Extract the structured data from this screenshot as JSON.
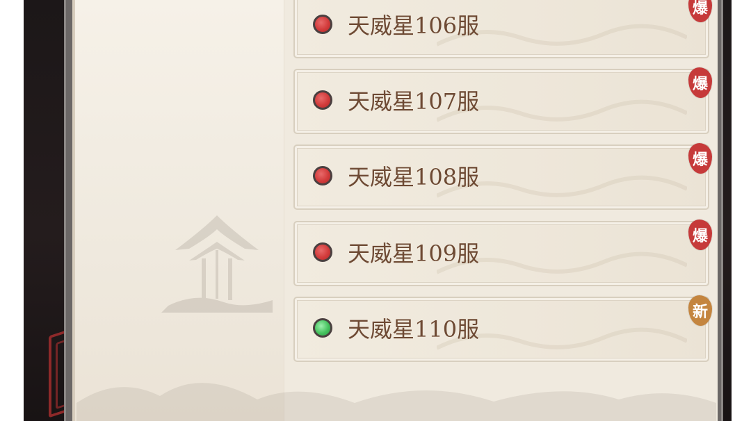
{
  "server_list": {
    "items": [
      {
        "name": "天威星106服",
        "status": "hot",
        "badge": "爆"
      },
      {
        "name": "天威星107服",
        "status": "hot",
        "badge": "爆"
      },
      {
        "name": "天威星108服",
        "status": "hot",
        "badge": "爆"
      },
      {
        "name": "天威星109服",
        "status": "hot",
        "badge": "爆"
      },
      {
        "name": "天威星110服",
        "status": "new",
        "badge": "新"
      }
    ]
  },
  "colors": {
    "hot_dot": "#d23b3b",
    "new_dot": "#45c25e",
    "hot_badge": "#c63a3a",
    "new_badge": "#c4853f",
    "server_text": "#6e4a34"
  },
  "icons": {
    "status_dot": "status-dot-icon",
    "decoration": "pavilion-ink-illustration"
  }
}
